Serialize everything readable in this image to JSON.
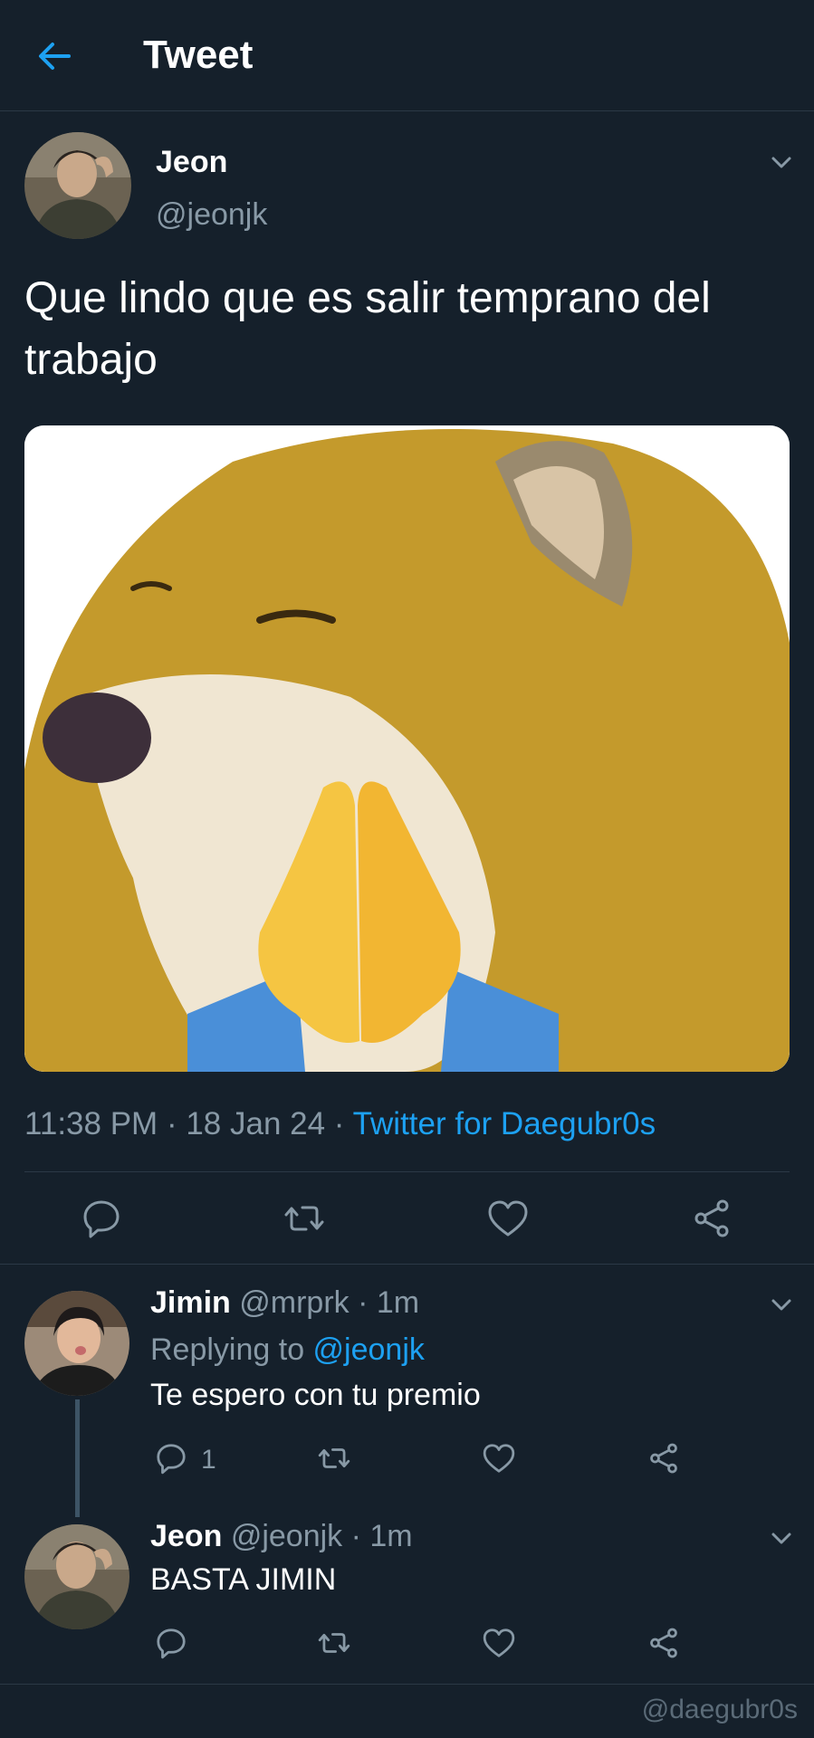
{
  "header": {
    "title": "Tweet",
    "back_icon": "arrow-left-icon"
  },
  "main_tweet": {
    "author_name": "Jeon",
    "author_handle": "@jeonjk",
    "text": "Que lindo que es salir temprano del trabajo",
    "media_icon": "praying-dog-image",
    "time": "11:38 PM",
    "date": "18 Jan 24",
    "separator": " · ",
    "source": "Twitter for Daegubr0s",
    "actions": [
      "reply-icon",
      "retweet-icon",
      "like-icon",
      "share-icon"
    ]
  },
  "replies": [
    {
      "name": "Jimin",
      "handle": "@mrprk",
      "time_sep": " · ",
      "time": "1m",
      "replying_label": "Replying to ",
      "replying_to": "@jeonjk",
      "text": "Te espero con tu premio",
      "reply_count": "1"
    },
    {
      "name": "Jeon",
      "handle": "@jeonjk",
      "time_sep": " · ",
      "time": "1m",
      "text": "BASTA JIMIN"
    }
  ],
  "watermark": "@daegubr0s",
  "colors": {
    "background": "#15202b",
    "accent": "#1da1f2",
    "muted": "#8899a6",
    "divider": "#2b3946"
  }
}
